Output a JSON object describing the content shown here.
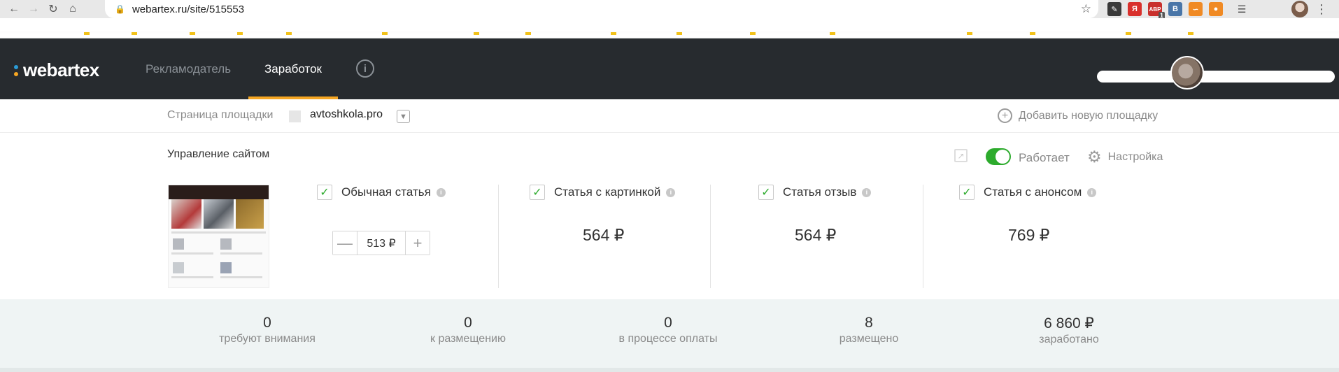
{
  "browser": {
    "url": "webartex.ru/site/515553",
    "extensions": [
      {
        "name": "pen-ext-icon",
        "text": "",
        "color": "#3a3a3a"
      },
      {
        "name": "yandex-ext-icon",
        "text": "Я",
        "color": "#d9302c"
      },
      {
        "name": "adblock-ext-icon",
        "text": "ABP",
        "color": "#c9302c",
        "badge": "1"
      },
      {
        "name": "vk-ext-icon",
        "text": "B",
        "color": "#4a76a8"
      },
      {
        "name": "rss-ext-icon",
        "text": "",
        "color": "#f08a24"
      },
      {
        "name": "ok-ext-icon",
        "text": "",
        "color": "#f08a24"
      }
    ]
  },
  "header": {
    "logo": "webartex",
    "tabs": [
      {
        "label": "Рекламодатель",
        "active": false
      },
      {
        "label": "Заработок",
        "active": true
      }
    ],
    "info_icon": "i"
  },
  "site_bar": {
    "label": "Страница площадки",
    "domain": "avtoshkola.pro",
    "add_site": "Добавить новую площадку"
  },
  "management": {
    "title": "Управление сайтом",
    "status_label": "Работает",
    "settings_label": "Настройка",
    "offers": [
      {
        "label": "Обычная статья",
        "checked": true,
        "stepper_value": "513 ₽"
      },
      {
        "label": "Статья с картинкой",
        "checked": true,
        "price": "564 ₽"
      },
      {
        "label": "Статья отзыв",
        "checked": true,
        "price": "564 ₽"
      },
      {
        "label": "Статья с анонсом",
        "checked": true,
        "price": "769 ₽"
      }
    ]
  },
  "stats": [
    {
      "value": "0",
      "caption": "требуют внимания"
    },
    {
      "value": "0",
      "caption": "к размещению"
    },
    {
      "value": "0",
      "caption": "в процессе оплаты"
    },
    {
      "value": "8",
      "caption": "размещено"
    },
    {
      "value": "6 860 ₽",
      "caption": "заработано"
    }
  ],
  "colors": {
    "accent": "#f5a623",
    "toggle_on": "#2dab2d",
    "header_bg": "#272b2f",
    "stats_bg": "#eff4f4"
  }
}
